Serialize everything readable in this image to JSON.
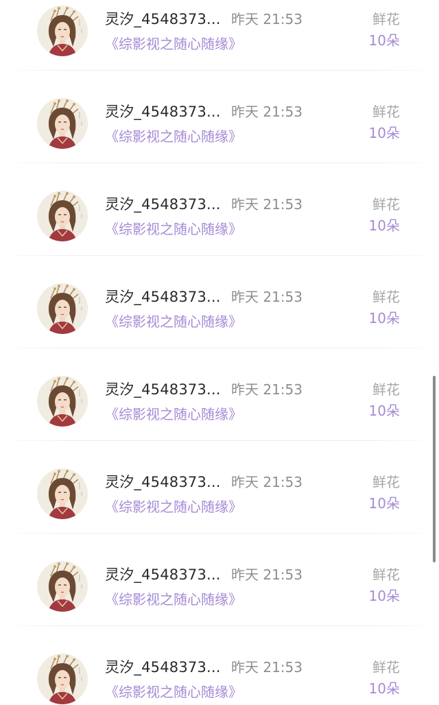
{
  "records": [
    {
      "name": "灵汐_4548373...",
      "time": "昨天 21:53",
      "book": "《综影视之随心随缘》",
      "gift": "鲜花",
      "count": "10朵",
      "avatar": "avatar-icon"
    },
    {
      "name": "灵汐_4548373...",
      "time": "昨天 21:53",
      "book": "《综影视之随心随缘》",
      "gift": "鲜花",
      "count": "10朵",
      "avatar": "avatar-icon"
    },
    {
      "name": "灵汐_4548373...",
      "time": "昨天 21:53",
      "book": "《综影视之随心随缘》",
      "gift": "鲜花",
      "count": "10朵",
      "avatar": "avatar-icon"
    },
    {
      "name": "灵汐_4548373...",
      "time": "昨天 21:53",
      "book": "《综影视之随心随缘》",
      "gift": "鲜花",
      "count": "10朵",
      "avatar": "avatar-icon"
    },
    {
      "name": "灵汐_4548373...",
      "time": "昨天 21:53",
      "book": "《综影视之随心随缘》",
      "gift": "鲜花",
      "count": "10朵",
      "avatar": "avatar-icon"
    },
    {
      "name": "灵汐_4548373...",
      "time": "昨天 21:53",
      "book": "《综影视之随心随缘》",
      "gift": "鲜花",
      "count": "10朵",
      "avatar": "avatar-icon"
    },
    {
      "name": "灵汐_4548373...",
      "time": "昨天 21:53",
      "book": "《综影视之随心随缘》",
      "gift": "鲜花",
      "count": "10朵",
      "avatar": "avatar-icon"
    },
    {
      "name": "灵汐_4548373...",
      "time": "昨天 21:53",
      "book": "《综影视之随心随缘》",
      "gift": "鲜花",
      "count": "10朵",
      "avatar": "avatar-icon"
    }
  ],
  "colors": {
    "name": "#2a2a2a",
    "time": "#8e8e8e",
    "accent": "#a58ad6",
    "gift_label": "#a5a5a5",
    "divider": "#ededed",
    "scrollbar": "#8a8a8a"
  },
  "scrollbar": {
    "position_fraction": 0.62
  }
}
